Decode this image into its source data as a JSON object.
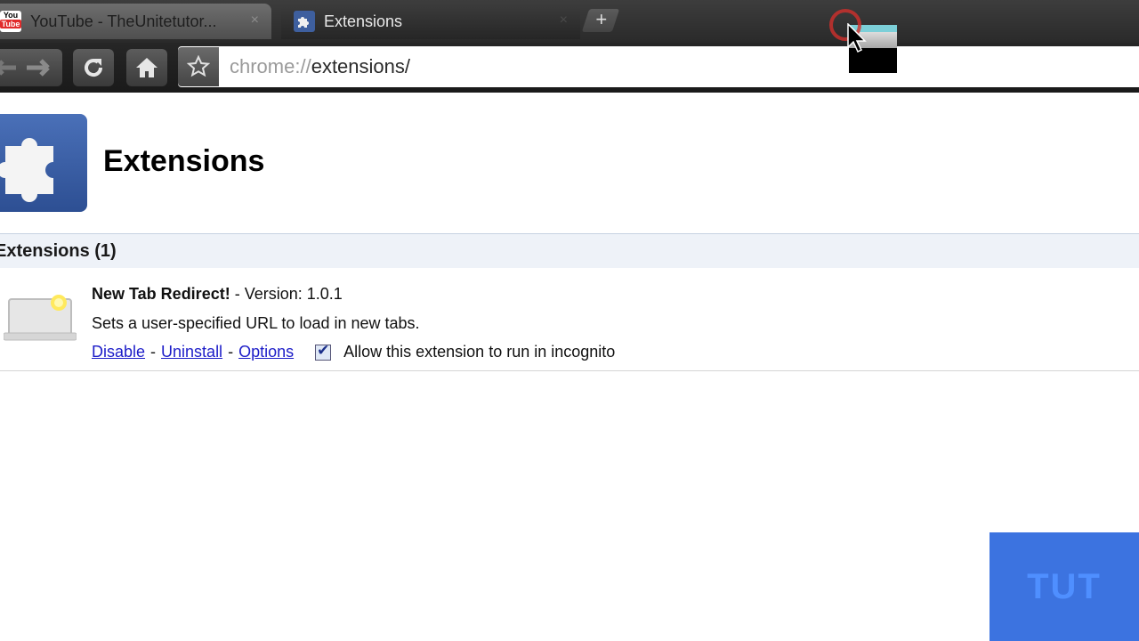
{
  "browser": {
    "tabs": [
      {
        "title": "YouTube - TheUnitetutor...",
        "close": "×",
        "favicon": "youtube-favicon",
        "favicon_text_top": "You",
        "favicon_text_bottom": "Tube",
        "active": false
      },
      {
        "title": "Extensions",
        "close": "×",
        "favicon": "puzzle-icon",
        "active": true
      }
    ],
    "new_tab_label": "+",
    "address": {
      "scheme": "chrome://",
      "path": "extensions/"
    }
  },
  "page": {
    "title": "Extensions",
    "section_title": "Extensions (1)",
    "extension": {
      "name": "New Tab Redirect!",
      "version_text": " - Version: 1.0.1",
      "description": "Sets a user-specified URL to load in new tabs.",
      "actions": {
        "disable": "Disable",
        "uninstall": "Uninstall",
        "options": "Options",
        "separator": "-"
      },
      "incognito_label": "Allow this extension to run in incognito",
      "incognito_checked": true
    }
  },
  "watermark": "TUT",
  "colors": {
    "link": "#1c1cc8",
    "section_bg": "#eef2f8",
    "logo_blue": "#3a5fa8",
    "watermark_bg": "#3c73e0"
  }
}
